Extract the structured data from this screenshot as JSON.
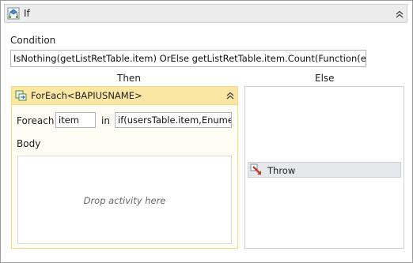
{
  "if_activity": {
    "title": "If",
    "icon": "if-activity-icon",
    "condition_label": "Condition",
    "condition_value": "IsNothing(getListRetTable.item) OrElse  getListRetTable.item.Count(Function(errIten",
    "then_label": "Then",
    "else_label": "Else"
  },
  "foreach_activity": {
    "title": "ForEach<BAPIUSNAME>",
    "icon": "foreach-activity-icon",
    "foreach_label": "Foreach",
    "item_value": "item",
    "in_label": "in",
    "collection_value": "if(usersTable.item,Enumera",
    "body_label": "Body",
    "drop_hint": "Drop activity here"
  },
  "throw_activity": {
    "title": "Throw",
    "icon": "throw-activity-icon"
  },
  "colors": {
    "foreach_header": "#fbe7a4",
    "foreach_border": "#f0d97e",
    "if_header": "#ececec",
    "throw_bg": "#e6e8ec"
  }
}
